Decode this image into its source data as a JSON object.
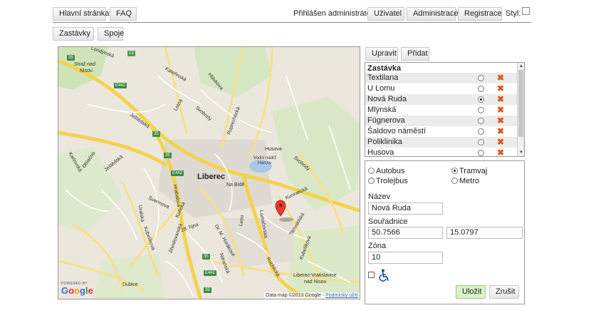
{
  "nav": {
    "home": "Hlavní stránka",
    "faq": "FAQ",
    "login_status": "Přihlášen administrátor.",
    "user": "Uživatel",
    "admin": "Administrace",
    "register": "Registrace",
    "style_label": "Styl:"
  },
  "subnav": {
    "stops": "Zastávky",
    "connections": "Spoje"
  },
  "actions": {
    "edit": "Upravit",
    "add": "Přidat"
  },
  "map": {
    "city": "Liberec",
    "powered": "POWERED BY",
    "logo": [
      "G",
      "o",
      "o",
      "g",
      "l",
      "e"
    ],
    "credit": "Data map ©2013 Google -",
    "terms": "Podmínky užití",
    "labels": {
      "a": "Straž nad",
      "b": "Nisou",
      "c": "Londýnská",
      "d": "Kateřinská",
      "e": "Hlávkova",
      "f": "Ještědská",
      "g": "Letná",
      "h": "Svobody",
      "i": "Ruprechtická",
      "j": "Husova",
      "k": "Vodní nádrž",
      "l": "Harcov",
      "m": "Na Bídě",
      "n": "Kunratická",
      "o": "Svobody",
      "p": "Karlovská",
      "q": "Oblačná",
      "r": "Ještědská",
      "s": "Švermova",
      "t": "Hrabalova",
      "u": "Kořická",
      "v": "28. října",
      "w": "Dr. M. Horákové",
      "x": "Jihoslovanská",
      "y": "Letní",
      "z": "Tanvaldská",
      "aa": "Rochlická",
      "ab": "Liberec-Vratislavice",
      "ac": "nad Nisou",
      "ad": "Dubice",
      "ae": "Uralská",
      "af": "Kubelíkova",
      "ag": "Nitranská",
      "ah": "Lamačovská",
      "ai": "Kubelíkova"
    },
    "shields": {
      "s35a": "35",
      "s13": "13",
      "s35b": "35",
      "s35c": "35",
      "s35d": "35",
      "e442a": "E442",
      "e442b": "E442",
      "e442c": "E442",
      "e442d": "E442",
      "e442e": "E442",
      "s35e": "35"
    }
  },
  "stops": {
    "header": "Zastávka",
    "rows": [
      {
        "name": "Textilana"
      },
      {
        "name": "U Lomu"
      },
      {
        "name": "Nová Ruda"
      },
      {
        "name": "Mlýnská"
      },
      {
        "name": "Fügnerova"
      },
      {
        "name": "Šaldovo náměstí"
      },
      {
        "name": "Poliklinika"
      },
      {
        "name": "Husova"
      }
    ],
    "selected_index": 2,
    "delete_icon": "✖"
  },
  "detail": {
    "types": {
      "bus": "Autobus",
      "tram": "Tramvaj",
      "trolley": "Trolejbus",
      "metro": "Metro"
    },
    "selected_type": "tram",
    "name_label": "Název",
    "name_value": "Nová Ruda",
    "coords_label": "Souřadnice",
    "lat": "50.7566",
    "lon": "15.0797",
    "zone_label": "Zóna",
    "zone_value": "10",
    "accessible_icon": "wheelchair-icon",
    "save": "Uložit",
    "cancel": "Zrušit"
  },
  "colors": {
    "accent_green": "#d9f2c8",
    "delete": "#e2541a",
    "marker": "#e43b2c"
  }
}
